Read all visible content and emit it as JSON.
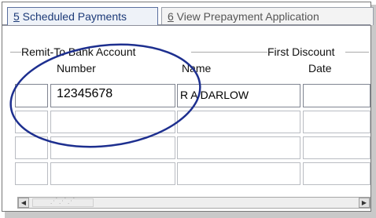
{
  "tabs": [
    {
      "mnemonic": "5",
      "label": " Scheduled Payments",
      "active": true
    },
    {
      "mnemonic": "6",
      "label": " View Prepayment Application",
      "active": false
    }
  ],
  "group": {
    "remit_label": "Remit-To Bank Account",
    "first_discount_label": "First Discount"
  },
  "columns": {
    "number": "Number",
    "name": "Name",
    "date": "Date"
  },
  "rows": [
    {
      "number": "12345678",
      "name": "R A DARLOW",
      "date": ""
    },
    {
      "number": "",
      "name": "",
      "date": ""
    },
    {
      "number": "",
      "name": "",
      "date": ""
    },
    {
      "number": "",
      "name": "",
      "date": ""
    }
  ],
  "annotation": {
    "shape": "ellipse",
    "color": "#1d2f8f"
  },
  "icons": {
    "scroll_left": "left-arrow-icon",
    "scroll_right": "right-arrow-icon"
  }
}
